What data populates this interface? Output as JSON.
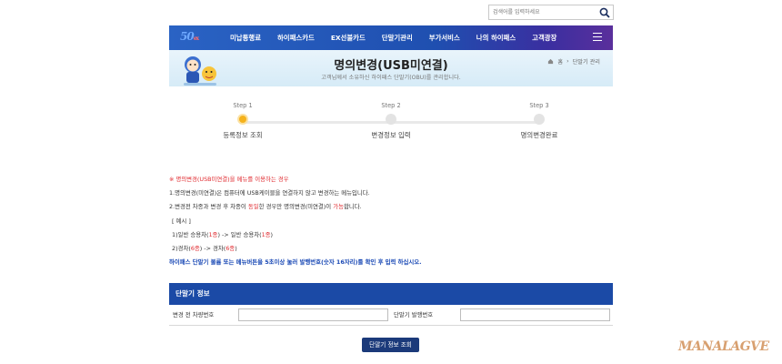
{
  "search": {
    "placeholder": "검색어를 입력하세요"
  },
  "nav": {
    "logo_main": "50",
    "logo_sub": "ex",
    "items": [
      "미납통행료",
      "하이패스카드",
      "EX선불카드",
      "단말기관리",
      "부가서비스",
      "나의 하이패스",
      "고객광장"
    ]
  },
  "banner": {
    "title": "명의변경(USB미연결)",
    "subtitle": "고객님께서 소유하신 하이패스 단말기(OBU)를 관리합니다.",
    "breadcrumb_home": "홈",
    "breadcrumb_current": "단말기 관리"
  },
  "steps": [
    {
      "num": "Step 1",
      "label": "등록정보 조회"
    },
    {
      "num": "Step 2",
      "label": "변경정보 입력"
    },
    {
      "num": "Step 3",
      "label": "명의변경완료"
    }
  ],
  "notice": {
    "heading": "※ 명의변경(USB미연결)을 메뉴를 이용하는 경우",
    "line1": "1.명의변경(미연결)은 컴퓨터에 USB케이블을 연결하지 않고 변경하는 메뉴입니다.",
    "line2_a": "2.변경전 차종과 변경 후 차종이 ",
    "line2_b": "동일",
    "line2_c": "한 경우만 명의변경(미연결)이 ",
    "line2_d": "가능",
    "line2_e": "합니다.",
    "example_label": "[ 예시 ]",
    "ex1_a": "1)일반 승용차(",
    "ex1_b": "1종",
    "ex1_c": ") -> 일반 승용차(",
    "ex1_d": "1종",
    "ex1_e": ")",
    "ex2_a": "2)경차(",
    "ex2_b": "6종",
    "ex2_c": ") -> 경차(",
    "ex2_d": "6종",
    "ex2_e": ")",
    "blue_line": "하이패스 단말기 볼륨 또는 메뉴버튼을 5초이상 눌러 발행번호(숫자 16자리)를 확인 후 입력 하십시오."
  },
  "info": {
    "heading": "단말기 정보",
    "plate_label": "변경 전 차량번호",
    "plate_value": "",
    "issue_label": "단말기 발행번호",
    "issue_value": "",
    "button": "단말기 정보 조회"
  },
  "watermark": "MANALAGVE",
  "colors": {
    "nav": "#1f4fb0",
    "header_bar": "#1b4aa6",
    "button": "#1b3a7a",
    "active_step": "#f5b21c",
    "notice_red": "#e0282d",
    "notice_blue": "#1a49b5"
  }
}
